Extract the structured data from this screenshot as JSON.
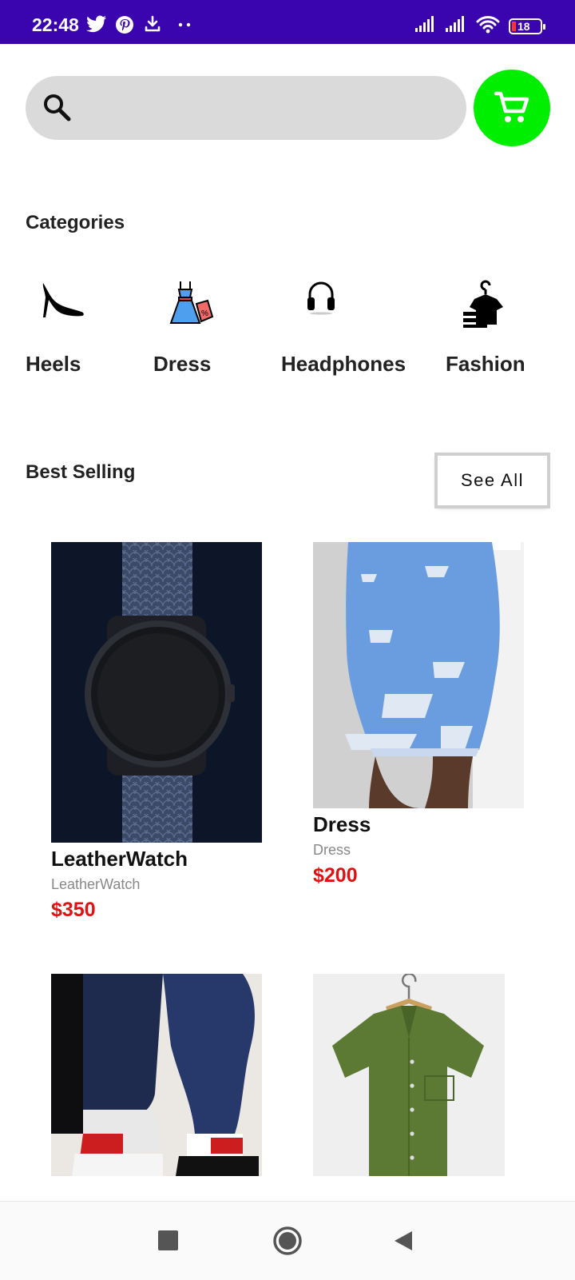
{
  "status_bar": {
    "time": "22:48",
    "battery_level": "18",
    "icons": [
      "twitter-icon",
      "pinterest-icon",
      "download-icon",
      "more-dots-icon",
      "signal-icon",
      "signal-icon",
      "wifi-icon",
      "battery-icon"
    ]
  },
  "search": {
    "placeholder": "",
    "value": ""
  },
  "cart": {
    "icon": "shopping-cart-icon",
    "color": "#00ee00"
  },
  "categories": {
    "title": "Categories",
    "items": [
      {
        "label": "Heels",
        "icon": "heels-icon"
      },
      {
        "label": "Dress",
        "icon": "dress-icon"
      },
      {
        "label": "Headphones",
        "icon": "headphones-icon"
      },
      {
        "label": "Fashion",
        "icon": "fashion-icon"
      }
    ]
  },
  "best_selling": {
    "title": "Best Selling",
    "see_all_label": "See All",
    "products": [
      {
        "name": "LeatherWatch",
        "subtitle": "LeatherWatch",
        "price": "$350"
      },
      {
        "name": "Dress",
        "subtitle": "Dress",
        "price": "$200"
      },
      {
        "name": "",
        "subtitle": "",
        "price": ""
      },
      {
        "name": "",
        "subtitle": "",
        "price": ""
      }
    ]
  },
  "colors": {
    "status_bar": "#3a04ae",
    "accent_cart": "#00ee00",
    "price": "#e31010"
  },
  "nav": {
    "icons": [
      "recents-square-icon",
      "home-circle-icon",
      "back-triangle-icon"
    ]
  }
}
